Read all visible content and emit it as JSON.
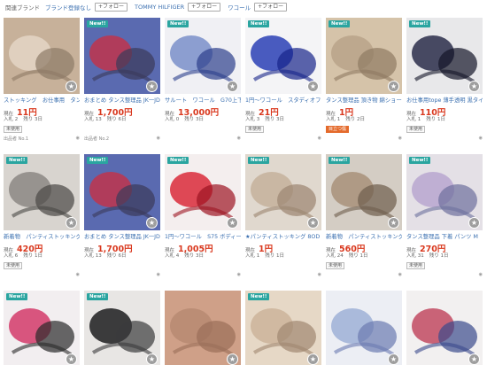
{
  "related": {
    "label": "関連ブランド",
    "items": [
      {
        "name": "ブランド登録なし",
        "follow": "+フォロー"
      },
      {
        "name": "TOMMY HILFIGER",
        "follow": "+フォロー"
      },
      {
        "name": "ワコール",
        "follow": "+フォロー"
      }
    ]
  },
  "labels": {
    "price": "現在",
    "bids": "入札",
    "left": "残り",
    "new_badge": "New!!"
  },
  "products": [
    {
      "title": "ストッキング　お仕事用　タンス",
      "price": "11円",
      "bids": "2",
      "left": "3日",
      "tag": "未使用",
      "seller": "出品者 No.1",
      "new": false,
      "colors": [
        "#c7b19a",
        "#e4d6c6",
        "#8d7a66"
      ]
    },
    {
      "title": "おまとめ タンス整理品 JK一JD一",
      "price": "1,700円",
      "bids": "13",
      "left": "6日",
      "tag": "",
      "seller": "出品者 No.2",
      "new": true,
      "colors": [
        "#5a6ab0",
        "#c0344c",
        "#3a3a5a"
      ]
    },
    {
      "title": "サルート　ワコール　G70上下",
      "price": "13,000円",
      "bids": "0",
      "left": "3日",
      "tag": "",
      "seller": "",
      "new": true,
      "colors": [
        "#f0f0f4",
        "#7a8fc9",
        "#2c3f8c"
      ]
    },
    {
      "title": "1円〜ワコール　スタディオファ",
      "price": "21円",
      "bids": "3",
      "left": "3日",
      "tag": "未使用",
      "seller": "",
      "new": true,
      "colors": [
        "#f4f4f6",
        "#2a3fb5",
        "#17248a"
      ]
    },
    {
      "title": "タンス整理品 頂き物 綿ショーツ",
      "price": "1円",
      "bids": "1",
      "left": "2日",
      "tag": "目立つ傷",
      "seller": "",
      "new": true,
      "colors": [
        "#d5c3a9",
        "#b9a389",
        "#8f7a63"
      ]
    },
    {
      "title": "お仕事用tope 薄手透明 黒タイツ",
      "price": "110円",
      "bids": "1",
      "left": "1日",
      "tag": "未使用",
      "seller": "",
      "new": true,
      "colors": [
        "#e8e8ea",
        "#2a2d4a",
        "#141628"
      ]
    },
    {
      "title": "新着物　パンティストッキング",
      "price": "420円",
      "bids": "6",
      "left": "1日",
      "tag": "未使用",
      "seller": "",
      "new": true,
      "colors": [
        "#d8d4cf",
        "#8c8784",
        "#4a4745"
      ]
    },
    {
      "title": "おまとめ タンス整理品 JK一JD一",
      "price": "1,700円",
      "bids": "13",
      "left": "6日",
      "tag": "",
      "seller": "",
      "new": true,
      "colors": [
        "#5a6ab0",
        "#c0344c",
        "#3a3a5a"
      ]
    },
    {
      "title": "1円〜ワコール　S75 ボディー",
      "price": "1,005円",
      "bids": "4",
      "left": "3日",
      "tag": "",
      "seller": "",
      "new": true,
      "colors": [
        "#f4eeee",
        "#d92a3a",
        "#9c1422"
      ]
    },
    {
      "title": "★パンティストッキング 8OD",
      "price": "1円",
      "bids": "1",
      "left": "1日",
      "tag": "",
      "seller": "",
      "new": true,
      "colors": [
        "#e0d8ce",
        "#c4b19b",
        "#9b8570"
      ]
    },
    {
      "title": "新着物　パンティストッキング",
      "price": "560円",
      "bids": "24",
      "left": "1日",
      "tag": "未使用",
      "seller": "",
      "new": true,
      "colors": [
        "#d4cdc4",
        "#a8917a",
        "#6e5d4c"
      ]
    },
    {
      "title": "タンス整理品 下着 パンツ M",
      "price": "270円",
      "bids": "31",
      "left": "1日",
      "tag": "未使用",
      "seller": "",
      "new": true,
      "colors": [
        "#e4e0e6",
        "#b8a6cf",
        "#6d6f9c"
      ]
    },
    {
      "title": "",
      "price": "",
      "bids": "",
      "left": "",
      "tag": "",
      "seller": "",
      "new": true,
      "colors": [
        "#f2eef0",
        "#d43a6a",
        "#2a2a2a"
      ]
    },
    {
      "title": "",
      "price": "",
      "bids": "",
      "left": "",
      "tag": "",
      "seller": "",
      "new": true,
      "colors": [
        "#e8e6e4",
        "#1c1c1e",
        "#3a3a3c"
      ]
    },
    {
      "title": "",
      "price": "",
      "bids": "",
      "left": "",
      "tag": "",
      "seller": "",
      "new": false,
      "colors": [
        "#cfa088",
        "#b78a72",
        "#9a6e58"
      ]
    },
    {
      "title": "",
      "price": "",
      "bids": "",
      "left": "",
      "tag": "",
      "seller": "",
      "new": true,
      "colors": [
        "#e6d8c6",
        "#cbb49a",
        "#a08770"
      ]
    },
    {
      "title": "",
      "price": "",
      "bids": "",
      "left": "",
      "tag": "",
      "seller": "",
      "new": false,
      "colors": [
        "#eceef4",
        "#9fb0d6",
        "#6b7ab0"
      ]
    },
    {
      "title": "",
      "price": "",
      "bids": "",
      "left": "",
      "tag": "",
      "seller": "",
      "new": false,
      "colors": [
        "#f2f0f0",
        "#c24a62",
        "#3b4a8c"
      ]
    }
  ]
}
